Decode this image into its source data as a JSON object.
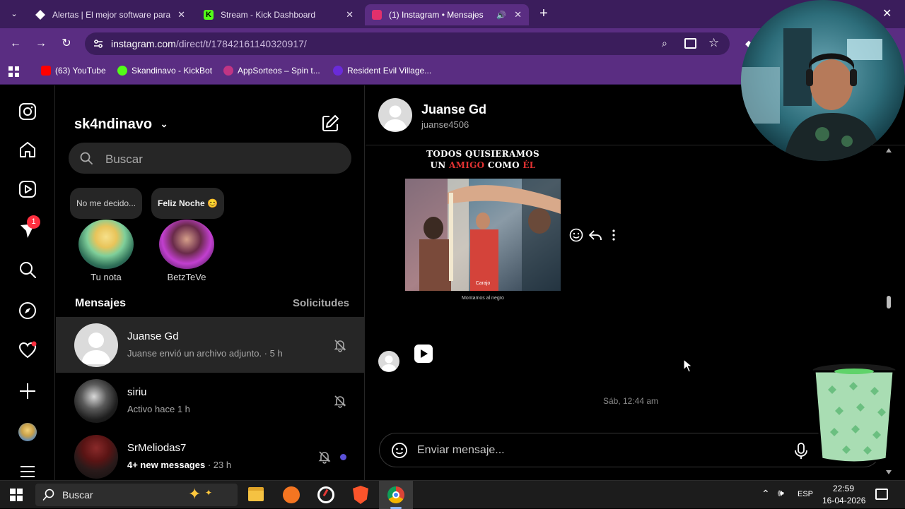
{
  "browser": {
    "tabs": [
      {
        "title": "Alertas | El mejor software para",
        "active": false,
        "favicon_color": "#ffffff"
      },
      {
        "title": "Stream - Kick Dashboard",
        "active": false,
        "favicon_color": "#53fc18"
      },
      {
        "title": "(1) Instagram • Mensajes",
        "active": true,
        "favicon_color": "#e1306c"
      }
    ],
    "url_host": "instagram.com",
    "url_path": "/direct/t/17842161140320917/",
    "bookmarks": [
      {
        "label": "(63) YouTube",
        "color": "#ff0000"
      },
      {
        "label": "Skandinavo - KickBot",
        "color": "#53fc18"
      },
      {
        "label": "AppSorteos – Spin t...",
        "color": "#c13584"
      },
      {
        "label": "Resident Evil Village...",
        "color": "#6a2bd9"
      }
    ]
  },
  "sidebar": {
    "notification_count": "1"
  },
  "inbox": {
    "username": "sk4ndinavo",
    "search_placeholder": "Buscar",
    "notes": [
      {
        "bubble": "No me decido...",
        "label": "Tu nota"
      },
      {
        "bubble": "Feliz Noche 😊",
        "label": "BetzTeVe"
      }
    ],
    "messages_heading": "Mensajes",
    "requests_label": "Solicitudes",
    "conversations": [
      {
        "name": "Juanse Gd",
        "subtitle": "Juanse envió un archivo adjunto. · 5 h",
        "selected": true
      },
      {
        "name": "siriu",
        "subtitle": "Activo hace 1 h",
        "selected": false
      },
      {
        "name": "SrMeliodas7",
        "subtitle_bold": "4+ new messages",
        "subtitle_time": " · 23 h",
        "selected": false
      }
    ]
  },
  "chat": {
    "name": "Juanse Gd",
    "handle": "juanse4506",
    "media_caption_line1": "TODOS QUISIERAMOS",
    "media_caption_a": "UN ",
    "media_caption_red1": "AMIGO",
    "media_caption_b": " COMO ",
    "media_caption_red2": "ÉL",
    "media_frame_text": "Carajo",
    "media_subtitle": "Montamos al negro",
    "timestamp": "Sáb, 12:44 am",
    "composer_placeholder": "Enviar mensaje..."
  },
  "taskbar": {
    "search_placeholder": "Buscar",
    "language": "ESP",
    "time": "22:59",
    "date": "16-04-2026"
  }
}
